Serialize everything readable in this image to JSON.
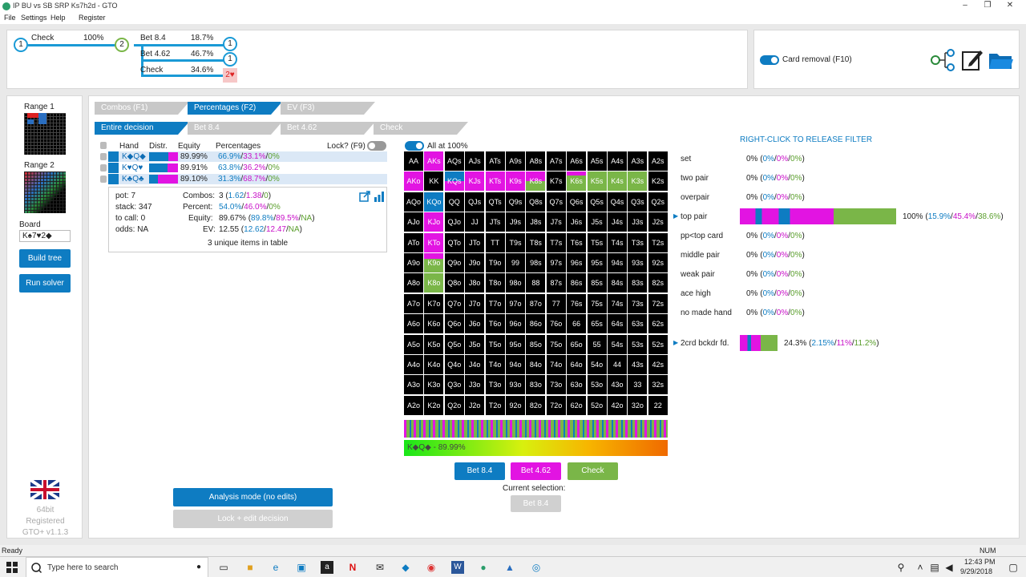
{
  "window": {
    "title": "IP BU vs SB SRP Ks7h2d - GTO",
    "min": "–",
    "max": "❐",
    "close": "✕"
  },
  "menu": [
    "File",
    "Settings",
    "Help",
    "Register"
  ],
  "tree": {
    "check": "Check",
    "check_pct": "100%",
    "bet1": "Bet 8.4",
    "bet1_pct": "18.7%",
    "bet2": "Bet 4.62",
    "bet2_pct": "46.7%",
    "chk2": "Check",
    "chk2_pct": "34.6%",
    "n1": "1",
    "n2": "2",
    "n3": "1",
    "n4": "1",
    "n5": "2♥"
  },
  "card_removal": "Card removal (F10)",
  "sidebar": {
    "range1": "Range 1",
    "range2": "Range 2",
    "board_label": "Board",
    "board_value": "K♠7♥2◆",
    "build": "Build tree",
    "run": "Run solver",
    "info1": "64bit",
    "info2": "Registered",
    "info3": "GTO+ v1.1.3"
  },
  "tabs1": [
    "Combos (F1)",
    "Percentages (F2)",
    "EV (F3)"
  ],
  "tabs2": [
    "Entire decision",
    "Bet 8.4",
    "Bet 4.62",
    "Check"
  ],
  "table": {
    "h_hand": "Hand",
    "h_distr": "Distr.",
    "h_equity": "Equity",
    "h_pct": "Percentages",
    "lock": "Lock? (F9)",
    "all": "All at 100%",
    "rows": [
      {
        "hand": "K◆Q◆",
        "equity": "89.99%",
        "p1": "66.9%",
        "p2": "33.1%",
        "p3": "0%"
      },
      {
        "hand": "K♥Q♥",
        "equity": "89.91%",
        "p1": "63.8%",
        "p2": "36.2%",
        "p3": "0%"
      },
      {
        "hand": "K♣Q♣",
        "equity": "89.10%",
        "p1": "31.3%",
        "p2": "68.7%",
        "p3": "0%"
      }
    ]
  },
  "stats": {
    "pot": "pot: 7",
    "stack": "stack: 347",
    "tocall": "to call: 0",
    "odds": "odds: NA",
    "combos": "Combos:",
    "combos_v": "3 (",
    "c1": "1.62",
    "c2": "1.38",
    "c3": "0",
    "percent": "Percent:",
    "pct1": "54.0%",
    "pct2": "46.0%",
    "pct3": "0%",
    "equity": "Equity:",
    "eq0": "89.67% (",
    "eq1": "89.8%",
    "eq2": "89.5%",
    "eq3": "NA",
    "ev": "EV:",
    "ev0": "12.55 (",
    "ev1": "12.62",
    "ev2": "12.47",
    "ev3": "NA",
    "unique": "3 unique items in table"
  },
  "grid": [
    [
      "AA",
      "AKs",
      "AQs",
      "AJs",
      "ATs",
      "A9s",
      "A8s",
      "A7s",
      "A6s",
      "A5s",
      "A4s",
      "A3s",
      "A2s"
    ],
    [
      "AKo",
      "KK",
      "KQs",
      "KJs",
      "KTs",
      "K9s",
      "K8s",
      "K7s",
      "K6s",
      "K5s",
      "K4s",
      "K3s",
      "K2s"
    ],
    [
      "AQo",
      "KQo",
      "QQ",
      "QJs",
      "QTs",
      "Q9s",
      "Q8s",
      "Q7s",
      "Q6s",
      "Q5s",
      "Q4s",
      "Q3s",
      "Q2s"
    ],
    [
      "AJo",
      "KJo",
      "QJo",
      "JJ",
      "JTs",
      "J9s",
      "J8s",
      "J7s",
      "J6s",
      "J5s",
      "J4s",
      "J3s",
      "J2s"
    ],
    [
      "ATo",
      "KTo",
      "QTo",
      "JTo",
      "TT",
      "T9s",
      "T8s",
      "T7s",
      "T6s",
      "T5s",
      "T4s",
      "T3s",
      "T2s"
    ],
    [
      "A9o",
      "K9o",
      "Q9o",
      "J9o",
      "T9o",
      "99",
      "98s",
      "97s",
      "96s",
      "95s",
      "94s",
      "93s",
      "92s"
    ],
    [
      "A8o",
      "K8o",
      "Q8o",
      "J8o",
      "T8o",
      "98o",
      "88",
      "87s",
      "86s",
      "85s",
      "84s",
      "83s",
      "82s"
    ],
    [
      "A7o",
      "K7o",
      "Q7o",
      "J7o",
      "T7o",
      "97o",
      "87o",
      "77",
      "76s",
      "75s",
      "74s",
      "73s",
      "72s"
    ],
    [
      "A6o",
      "K6o",
      "Q6o",
      "J6o",
      "T6o",
      "96o",
      "86o",
      "76o",
      "66",
      "65s",
      "64s",
      "63s",
      "62s"
    ],
    [
      "A5o",
      "K5o",
      "Q5o",
      "J5o",
      "T5o",
      "95o",
      "85o",
      "75o",
      "65o",
      "55",
      "54s",
      "53s",
      "52s"
    ],
    [
      "A4o",
      "K4o",
      "Q4o",
      "J4o",
      "T4o",
      "94o",
      "84o",
      "74o",
      "64o",
      "54o",
      "44",
      "43s",
      "42s"
    ],
    [
      "A3o",
      "K3o",
      "Q3o",
      "J3o",
      "T3o",
      "93o",
      "83o",
      "73o",
      "63o",
      "53o",
      "43o",
      "33",
      "32s"
    ],
    [
      "A2o",
      "K2o",
      "Q2o",
      "J2o",
      "T2o",
      "92o",
      "82o",
      "72o",
      "62o",
      "52o",
      "42o",
      "32o",
      "22"
    ]
  ],
  "gradient_label": "K◆Q◆ - 89.99%",
  "actions": {
    "bet84": "Bet 8.4",
    "bet462": "Bet 4.62",
    "check": "Check",
    "current": "Current selection:",
    "sel": "Bet 8.4"
  },
  "mode": {
    "analysis": "Analysis mode (no edits)",
    "lock": "Lock + edit decision"
  },
  "filter_title": "RIGHT-CLICK TO RELEASE FILTER",
  "cats": [
    {
      "name": "set",
      "v": "0%",
      "a": "0%",
      "b": "0%",
      "c": "0%"
    },
    {
      "name": "two pair",
      "v": "0%",
      "a": "0%",
      "b": "0%",
      "c": "0%"
    },
    {
      "name": "overpair",
      "v": "0%",
      "a": "0%",
      "b": "0%",
      "c": "0%"
    },
    {
      "name": "top pair",
      "v": "100%",
      "a": "15.9%",
      "b": "45.4%",
      "c": "38.6%"
    },
    {
      "name": "pp<top card",
      "v": "0%",
      "a": "0%",
      "b": "0%",
      "c": "0%"
    },
    {
      "name": "middle pair",
      "v": "0%",
      "a": "0%",
      "b": "0%",
      "c": "0%"
    },
    {
      "name": "weak pair",
      "v": "0%",
      "a": "0%",
      "b": "0%",
      "c": "0%"
    },
    {
      "name": "ace high",
      "v": "0%",
      "a": "0%",
      "b": "0%",
      "c": "0%"
    },
    {
      "name": "no made hand",
      "v": "0%",
      "a": "0%",
      "b": "0%",
      "c": "0%"
    },
    {
      "name": "2crd bckdr fd.",
      "v": "24.3%",
      "a": "2.15%",
      "b": "11%",
      "c": "11.2%"
    }
  ],
  "status": {
    "ready": "Ready",
    "num": "NUM"
  },
  "taskbar": {
    "search": "Type here to search",
    "time": "12:43 PM",
    "date": "9/29/2018"
  },
  "colors": {
    "blue": "#0e7cc2",
    "pink": "#e214e2",
    "green": "#7ab648"
  }
}
